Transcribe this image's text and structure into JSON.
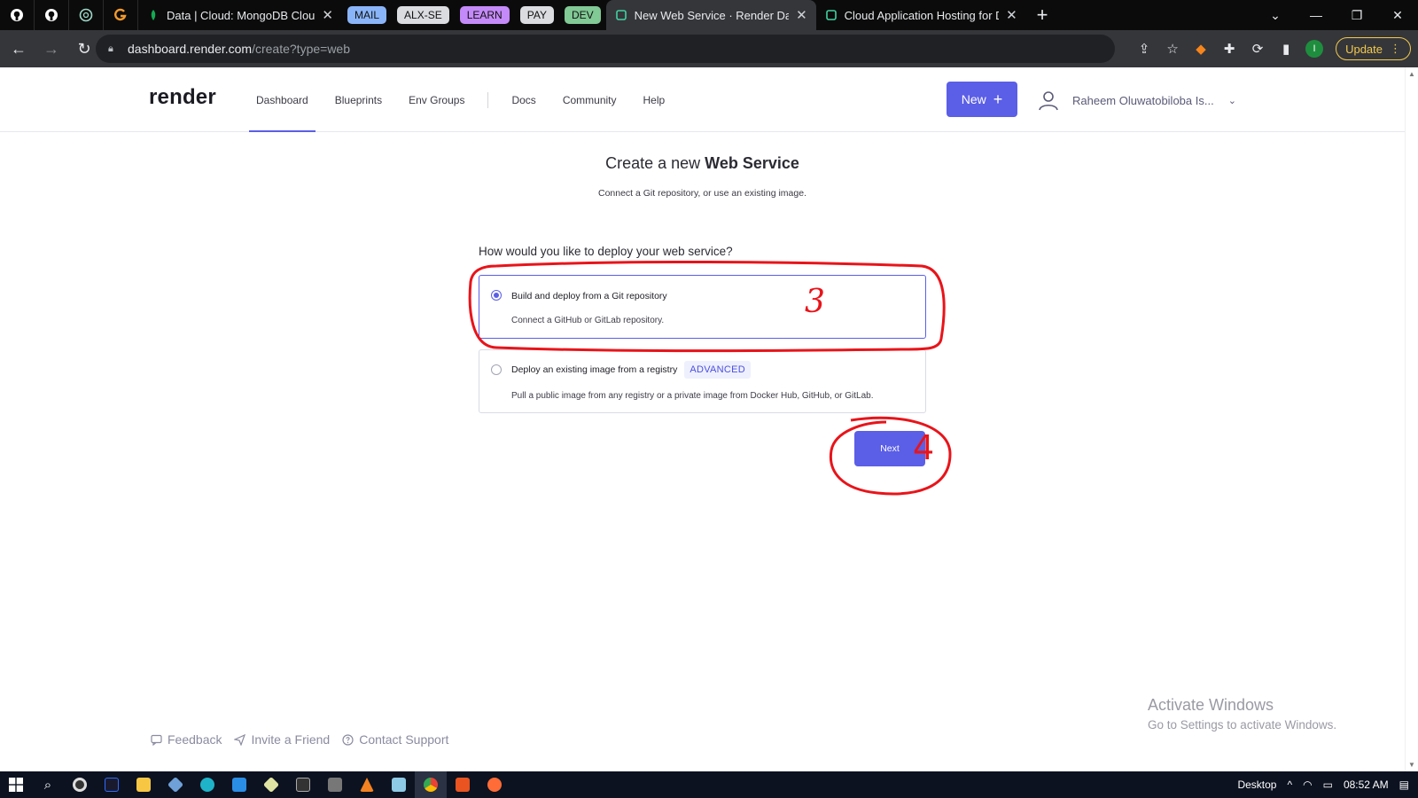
{
  "browser": {
    "tabs": [
      {
        "title": "Data | Cloud: MongoDB Cloud",
        "active": false
      },
      {
        "title": "New Web Service · Render Dashb",
        "active": true
      },
      {
        "title": "Cloud Application Hosting for De",
        "active": false
      }
    ],
    "groups": [
      {
        "label": "MAIL",
        "color": "#8ab4f8"
      },
      {
        "label": "ALX-SE",
        "color": "#dadce0"
      },
      {
        "label": "LEARN",
        "color": "#c58af9"
      },
      {
        "label": "PAY",
        "color": "#dadce0"
      },
      {
        "label": "DEV",
        "color": "#81c995"
      }
    ],
    "url_host": "dashboard.render.com",
    "url_path": "/create?type=web",
    "update_label": "Update",
    "profile_initial": "I"
  },
  "header": {
    "logo": "render",
    "nav": {
      "dashboard": "Dashboard",
      "blueprints": "Blueprints",
      "env_groups": "Env Groups",
      "docs": "Docs",
      "community": "Community",
      "help": "Help"
    },
    "new_label": "New",
    "user_name": "Raheem Oluwatobiloba Is..."
  },
  "main": {
    "title_prefix": "Create a new",
    "title_bold": "Web Service",
    "subtitle": "Connect a Git repository, or use an existing image.",
    "question": "How would you like to deploy your web service?",
    "options": [
      {
        "title": "Build and deploy from a Git repository",
        "desc": "Connect a GitHub or GitLab repository.",
        "selected": true
      },
      {
        "title": "Deploy an existing image from a registry",
        "badge": "ADVANCED",
        "desc": "Pull a public image from any registry or a private image from Docker Hub, GitHub, or GitLab.",
        "selected": false
      }
    ],
    "next_label": "Next"
  },
  "annotations": {
    "step_3": "3",
    "step_4": "4",
    "color": "#e8141a"
  },
  "footer": {
    "feedback": "Feedback",
    "invite": "Invite a Friend",
    "support": "Contact Support"
  },
  "watermark": {
    "line1": "Activate Windows",
    "line2": "Go to Settings to activate Windows."
  },
  "taskbar": {
    "desktop_label": "Desktop",
    "time": "08:52 AM"
  },
  "colors": {
    "accent": "#5b5ee6"
  }
}
